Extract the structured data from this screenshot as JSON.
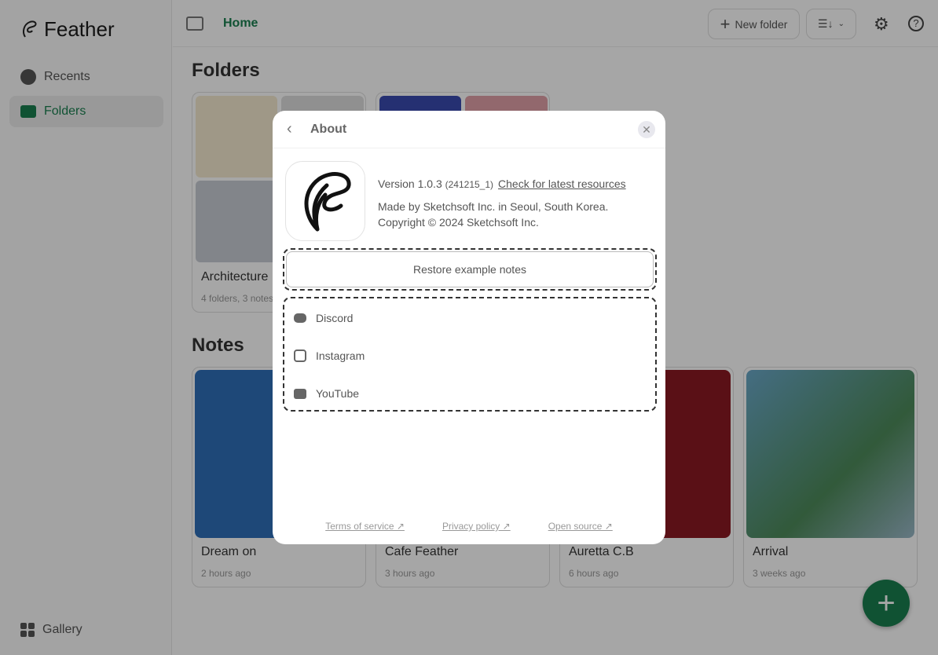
{
  "app": {
    "name": "Feather"
  },
  "sidebar": {
    "items": [
      {
        "label": "Recents",
        "icon": "clock-icon"
      },
      {
        "label": "Folders",
        "icon": "folder-icon",
        "active": true
      }
    ],
    "bottom": {
      "label": "Gallery",
      "icon": "gallery-icon"
    }
  },
  "topbar": {
    "breadcrumb": "Home",
    "new_folder": "New folder"
  },
  "folders": {
    "heading": "Folders",
    "items": [
      {
        "title": "Architecture",
        "subtitle": "4 folders, 3 notes"
      }
    ]
  },
  "notes": {
    "heading": "Notes",
    "items": [
      {
        "title": "Dream on",
        "subtitle": "2 hours ago"
      },
      {
        "title": "Cafe Feather",
        "subtitle": "3 hours ago"
      },
      {
        "title": "Auretta C.B",
        "subtitle": "6 hours ago"
      },
      {
        "title": "Arrival",
        "subtitle": "3 weeks ago"
      }
    ]
  },
  "about": {
    "title": "About",
    "version": "Version 1.0.3",
    "build": "(241215_1)",
    "check": "Check for latest resources",
    "made_by": "Made by Sketchsoft Inc. in Seoul, South Korea.",
    "copyright": "Copyright © 2024 Sketchsoft Inc.",
    "restore": "Restore example notes",
    "links": [
      {
        "label": "Discord",
        "icon": "discord-icon"
      },
      {
        "label": "Instagram",
        "icon": "instagram-icon"
      },
      {
        "label": "YouTube",
        "icon": "youtube-icon"
      }
    ],
    "footer": [
      "Terms of service ↗",
      "Privacy policy ↗",
      "Open source ↗"
    ]
  },
  "colors": {
    "accent": "#1a7f4f"
  }
}
